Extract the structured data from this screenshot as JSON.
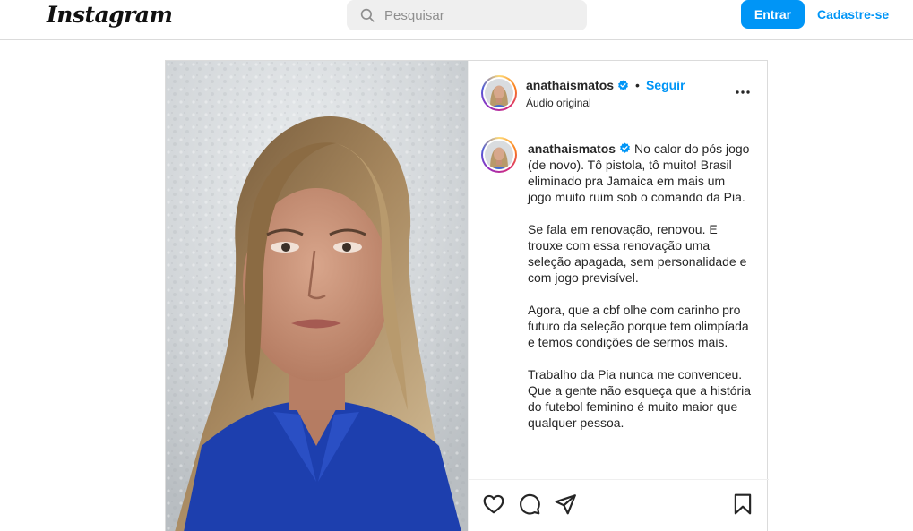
{
  "header": {
    "logo_text": "Instagram",
    "search_placeholder": "Pesquisar",
    "login_label": "Entrar",
    "signup_label": "Cadastre-se"
  },
  "post": {
    "username": "anathaismatos",
    "dot": "•",
    "follow_label": "Seguir",
    "audio_label": "Áudio original",
    "caption_username": "anathaismatos",
    "caption_paragraphs": [
      "No calor do pós jogo (de novo). Tô pistola, tô muito! Brasil eliminado pra Jamaica em mais um jogo muito ruim sob o comando da Pia.",
      "Se fala em renovação, renovou. E trouxe com essa renovação uma seleção apagada, sem personalidade e com jogo previsível.",
      "Agora, que a cbf olhe com carinho pro futuro da seleção porque tem olimpíada e temos condições de sermos mais.",
      "Trabalho da Pia nunca me convenceu. Que a gente não esqueça que a história do futebol feminino é muito maior que qualquer pessoa."
    ]
  },
  "colors": {
    "accent": "#0095f6",
    "border": "#dbdbdb",
    "text": "#262626"
  },
  "icons": [
    "search-icon",
    "verified-icon",
    "more-icon",
    "heart-icon",
    "comment-icon",
    "share-icon",
    "bookmark-icon"
  ]
}
